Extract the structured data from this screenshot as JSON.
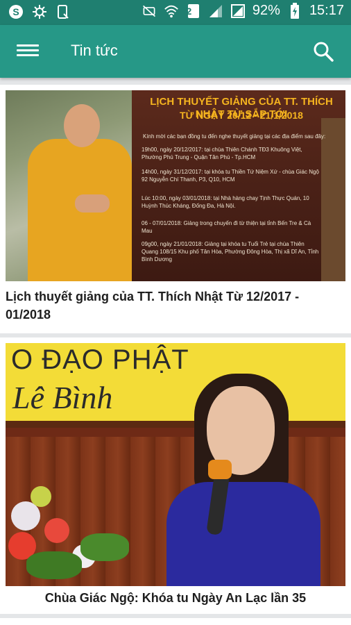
{
  "status_bar": {
    "battery_percent": "92%",
    "time": "15:17",
    "sim_slot": "2",
    "icons": [
      "skype-icon",
      "settings-icon",
      "notification-icon",
      "mute-icon",
      "wifi-icon",
      "sim-icon",
      "signal-icon",
      "signal-icon-2",
      "battery-icon"
    ]
  },
  "app_bar": {
    "title": "Tin tức",
    "menu_icon": "menu-icon",
    "search_icon": "search-icon",
    "color": "#269887"
  },
  "articles": [
    {
      "title": "Lịch thuyết giảng của TT. Thích Nhật Từ 12/2017 - 01/2018",
      "thumbnail": {
        "heading": "LỊCH THUYẾT GIẢNG CỦA TT. THÍCH NHẬT TỪ SẮP TỚI",
        "subheading": "TỪ NGÀY 20/12 - 21/1/2018",
        "intro": "Kính mời các bạn đồng tu đến nghe thuyết giảng tại các địa điểm sau đây:",
        "lines": [
          "19h00, ngày 20/12/2017: tại chùa Thiên Chánh TĐ3 Khuông Việt, Phường Phú Trung - Quận Tân Phú - Tp.HCM",
          "14h00, ngày 31/12/2017: tại khóa tu Thiền Tứ Niệm Xứ - chùa Giác Ngộ 92 Nguyễn Chí Thanh, P3, Q10, HCM",
          "Lúc 10:00, ngày 03/01/2018: tại Nhà hàng chay Tịnh Thực Quán, 10 Huỳnh Thúc Kháng, Đống Đa, Hà Nội.",
          "06 - 07/01/2018: Giảng trong chuyến đi từ thiện tại tỉnh Bến Tre & Cà Mau",
          "09g00, ngày 21/01/2018: Giảng tại khóa tu Tuổi Trẻ tại chùa Thiên Quang 108/15 Khu phố Tân Hòa, Phường Đông Hòa, Thị xã Dĩ An, Tỉnh Bình Dương"
        ]
      }
    },
    {
      "title": "Chùa Giác Ngộ: Khóa tu Ngày An Lạc lần 35",
      "thumbnail": {
        "banner_line1": "O ĐẠO PHẬT",
        "banner_line2": "Lê Bình"
      }
    }
  ]
}
